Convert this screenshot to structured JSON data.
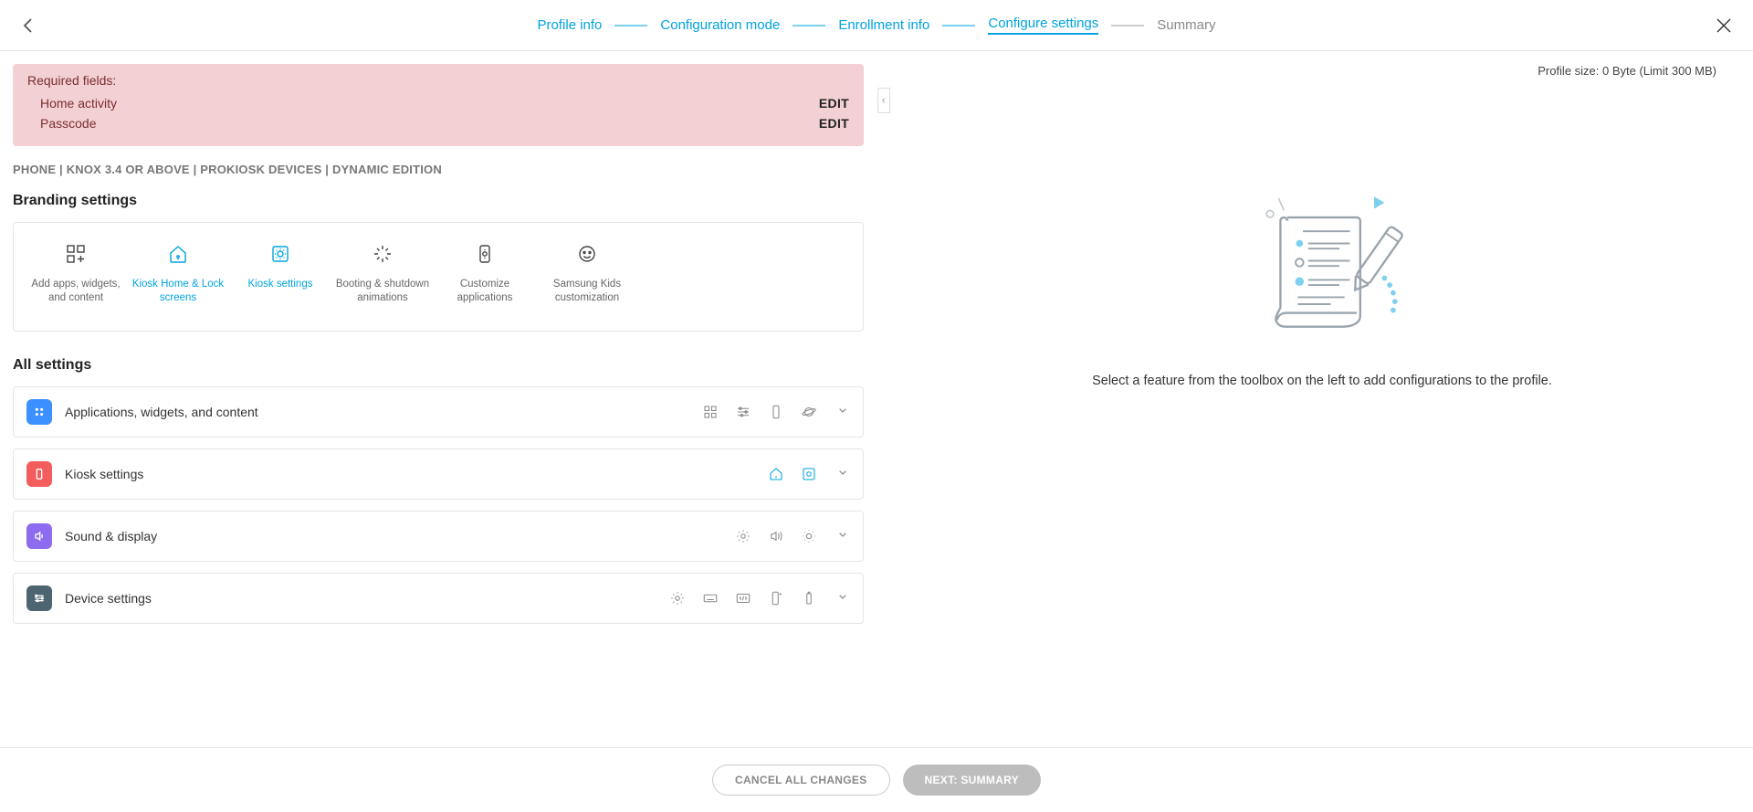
{
  "stepper": {
    "steps": [
      {
        "label": "Profile info"
      },
      {
        "label": "Configuration mode"
      },
      {
        "label": "Enrollment info"
      },
      {
        "label": "Configure settings"
      },
      {
        "label": "Summary"
      }
    ]
  },
  "required": {
    "title": "Required fields:",
    "items": [
      {
        "label": "Home activity",
        "action": "EDIT"
      },
      {
        "label": "Passcode",
        "action": "EDIT"
      }
    ]
  },
  "subheader": "PHONE | KNOX 3.4 OR ABOVE | PROKIOSK DEVICES | DYNAMIC EDITION",
  "sections": {
    "branding_title": "Branding settings",
    "all_title": "All settings"
  },
  "branding": [
    {
      "label": "Add apps, widgets, and content"
    },
    {
      "label": "Kiosk Home & Lock screens"
    },
    {
      "label": "Kiosk settings"
    },
    {
      "label": "Booting & shutdown animations"
    },
    {
      "label": "Customize applications"
    },
    {
      "label": "Samsung Kids customization"
    }
  ],
  "all_settings": [
    {
      "label": "Applications, widgets, and content"
    },
    {
      "label": "Kiosk settings"
    },
    {
      "label": "Sound & display"
    },
    {
      "label": "Device settings"
    }
  ],
  "right": {
    "profile_size": "Profile size: 0 Byte (Limit 300 MB)",
    "message": "Select a feature from the toolbox on the left to add configurations to the profile."
  },
  "footer": {
    "cancel": "CANCEL ALL CHANGES",
    "next": "NEXT: SUMMARY"
  }
}
